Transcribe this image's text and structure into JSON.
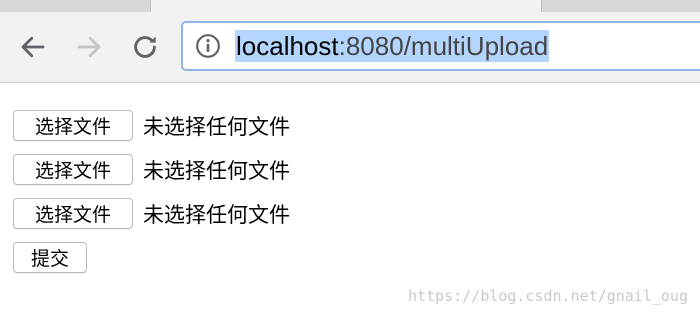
{
  "browser": {
    "url_host": "localhost",
    "url_rest": ":8080/multiUpload"
  },
  "form": {
    "rows": [
      {
        "button_label": "选择文件",
        "status": "未选择任何文件"
      },
      {
        "button_label": "选择文件",
        "status": "未选择任何文件"
      },
      {
        "button_label": "选择文件",
        "status": "未选择任何文件"
      }
    ],
    "submit_label": "提交"
  },
  "watermark": "https://blog.csdn.net/gnail_oug",
  "colors": {
    "url_highlight": "#b4d5fe",
    "omnibox_focus_border": "#8db4e8"
  },
  "icons": [
    "back-icon",
    "forward-icon",
    "reload-icon",
    "info-icon"
  ]
}
